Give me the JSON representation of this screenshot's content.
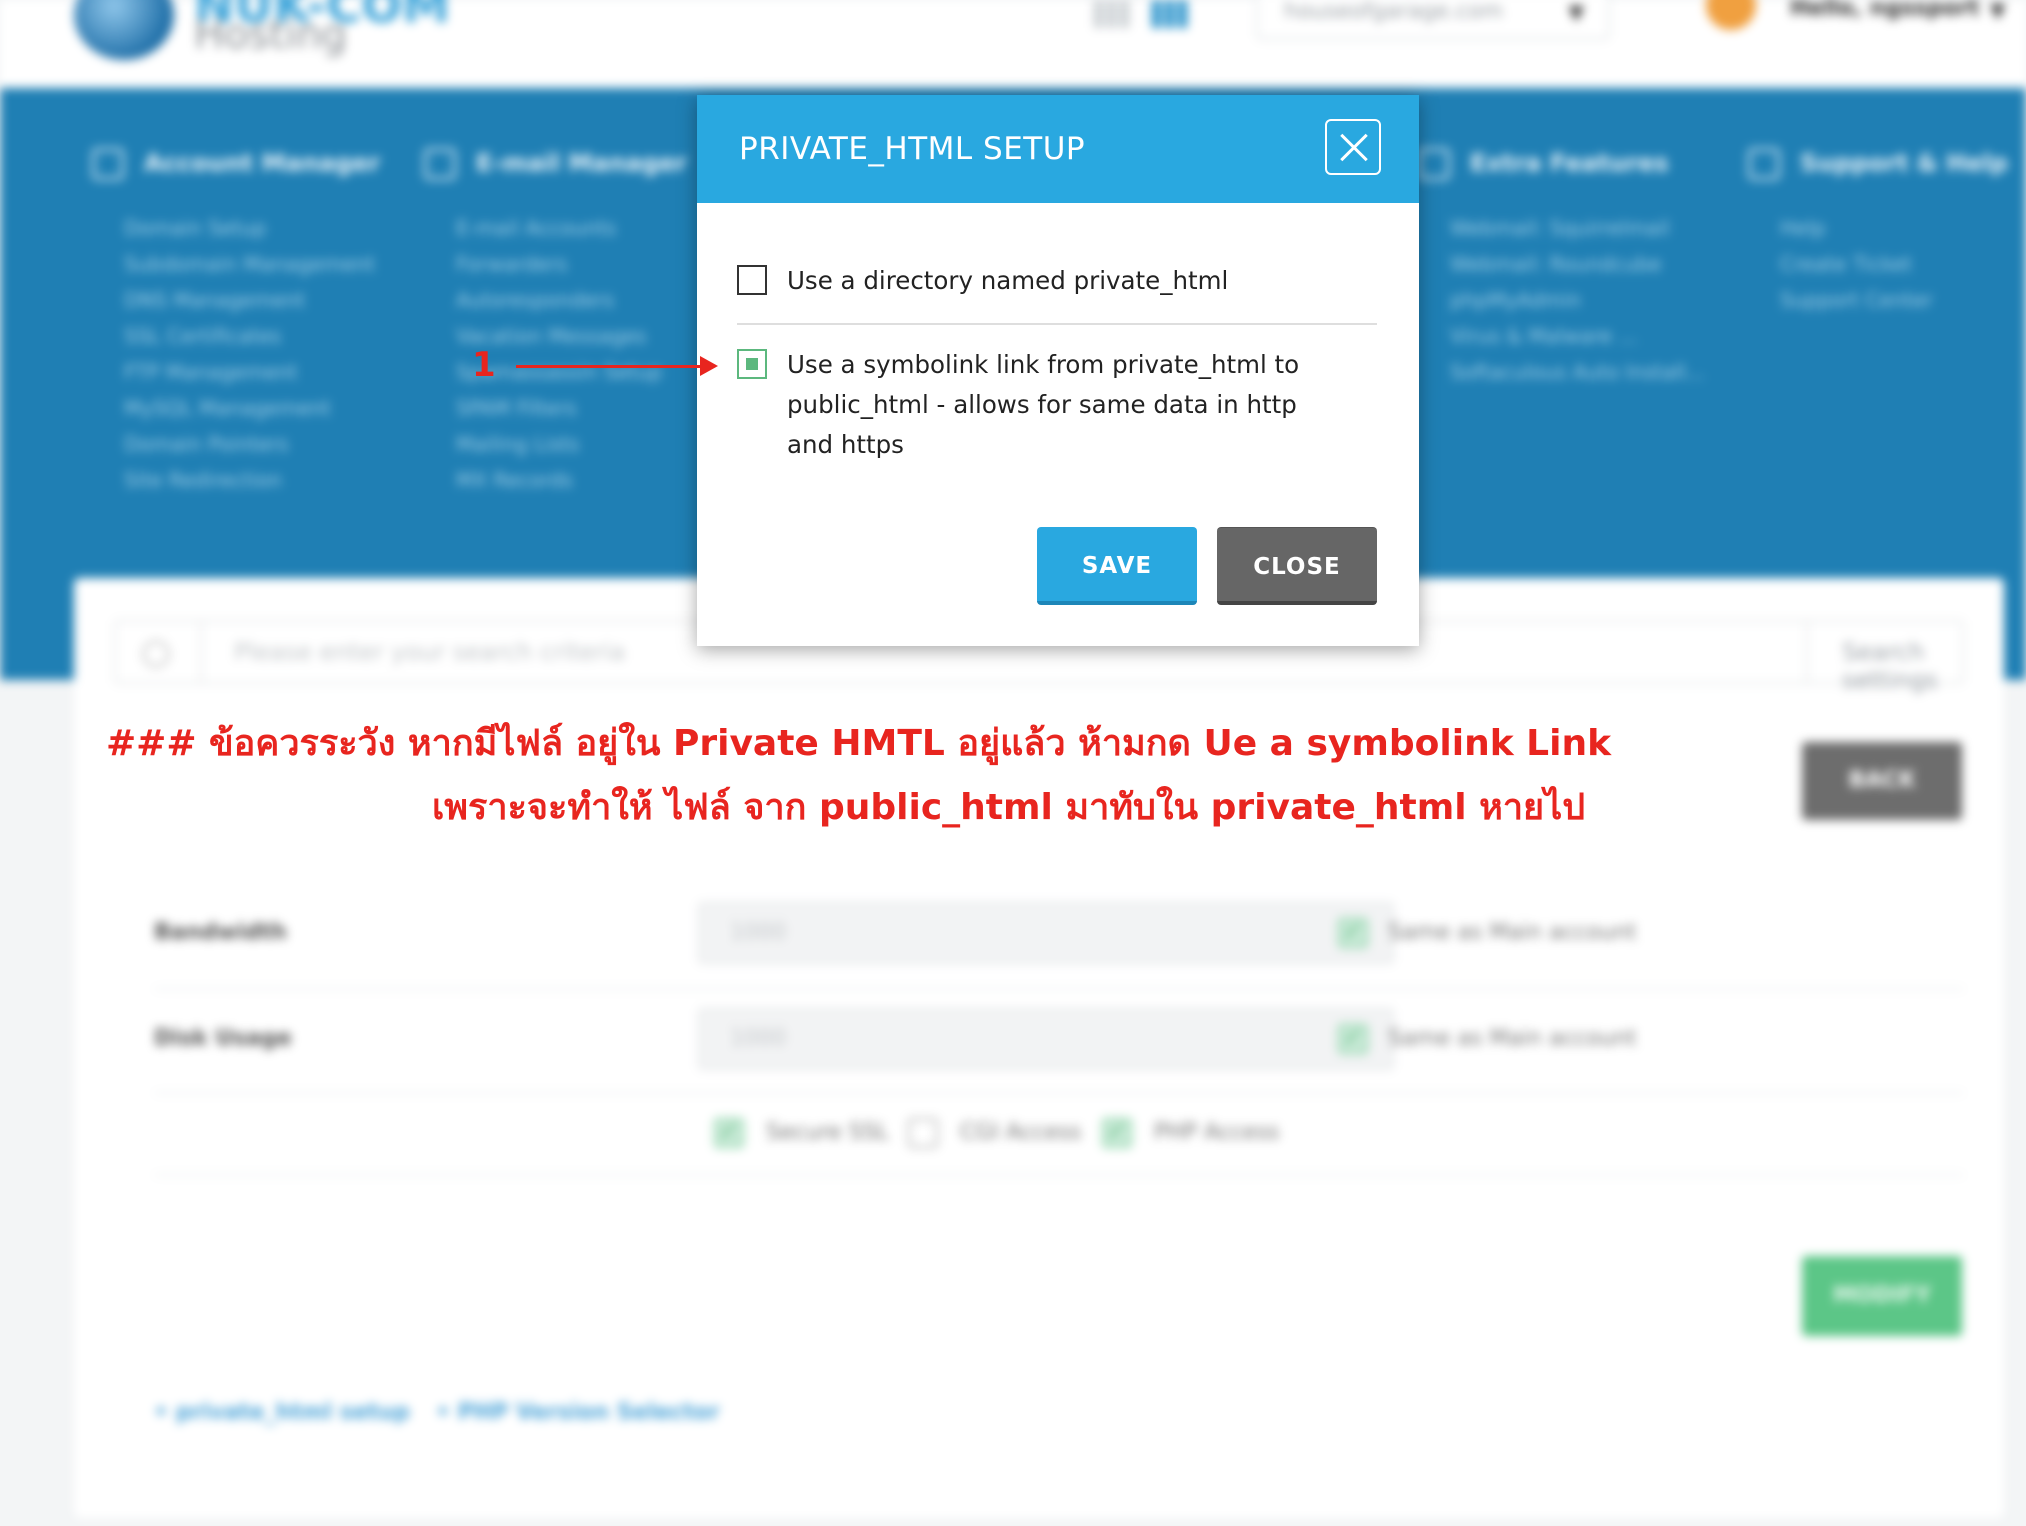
{
  "header": {
    "logo_line1": "NUK-COM",
    "logo_line2": "Hosting",
    "domain_select_value": "houseofgarage.com",
    "greeting": "Hello, ngssport"
  },
  "nav": {
    "columns": [
      {
        "title": "Account Manager",
        "items": [
          "Domain Setup",
          "Subdomain Management",
          "DNS Management",
          "SSL Certificates",
          "FTP Management",
          "MySQL Management",
          "Domain Pointers",
          "Site Redirection"
        ]
      },
      {
        "title": "E-mail Manager",
        "items": [
          "E-mail Accounts",
          "Forwarders",
          "Autoresponders",
          "Vacation Messages",
          "Spamassassin Setup",
          "SPAM Filters",
          "Mailing Lists",
          "MX Records"
        ]
      },
      {
        "title": "Extra Features",
        "items": [
          "Webmail: Squirrelmail",
          "Webmail: Roundcube",
          "phpMyAdmin",
          "Virus & Malware ...",
          "Softaculous Auto Install..."
        ]
      },
      {
        "title": "Support & Help",
        "items": [
          "Help",
          "Create Ticket",
          "Support Center"
        ]
      }
    ]
  },
  "search": {
    "placeholder": "Please enter your search criteria",
    "settings_label": "Search settings"
  },
  "page": {
    "back_label": "BACK",
    "bandwidth_label": "Bandwidth",
    "bandwidth_value": "1000",
    "disk_label": "Disk Usage",
    "disk_value": "1000",
    "same_as_main": "Same as Main account",
    "secure_ssl": "Secure SSL",
    "cgi_access": "CGI Access",
    "php_access": "PHP Access",
    "modify_label": "MODIFY",
    "links": [
      "• private_html setup",
      "• PHP Version Selector"
    ]
  },
  "warning": {
    "line1": "### ข้อควรระวัง หากมีไฟล์ อยู่ใน Private HMTL อยู่แล้ว ห้ามกด Ue a symbolink  Link",
    "line2": "เพราะจะทำให้ ไฟล์ จาก public_html มาทับใน private_html หายไป"
  },
  "modal": {
    "title": "PRIVATE_HTML SETUP",
    "option1_label": "Use a directory named private_html",
    "option1_checked": false,
    "option2_label": "Use a symbolink link from private_html to public_html - allows for same data in http and https",
    "option2_checked": true,
    "save_label": "SAVE",
    "close_label": "CLOSE"
  },
  "annotation": {
    "number": "1"
  },
  "colors": {
    "nav_blue": "#1f7fb4",
    "modal_header": "#29a8e0",
    "warning_red": "#e8251f",
    "check_green": "#5cb87e"
  }
}
